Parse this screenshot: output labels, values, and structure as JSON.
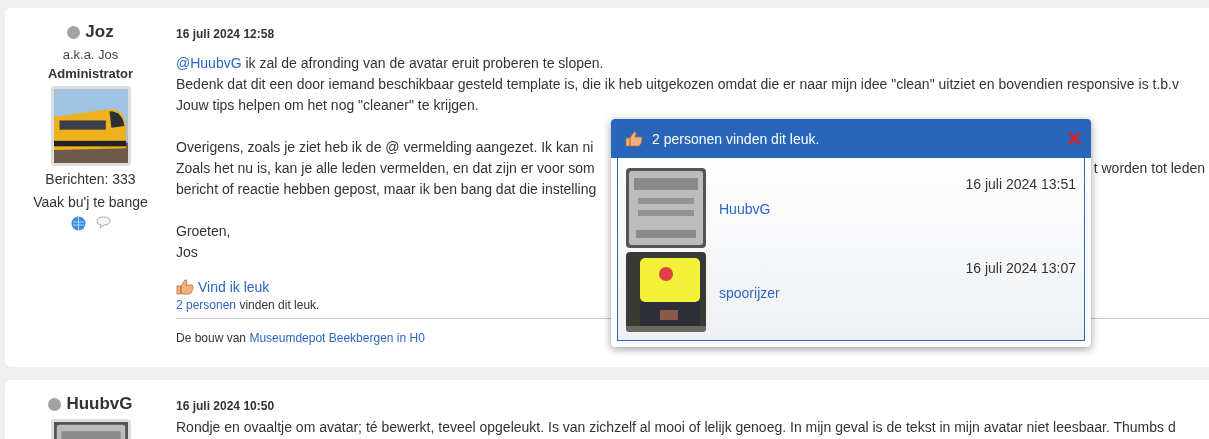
{
  "posts": [
    {
      "author": "Joz",
      "online": false,
      "alias": "a.k.a. Jos",
      "rank": "Administrator",
      "avatar": {
        "kind": "picture"
      },
      "post_count": "Berichten: 333",
      "personal_text": "Vaak bu'j te bange",
      "date": "16 juli 2024 12:58",
      "lines": [
        {
          "kind": "text",
          "segments": [
            {
              "kind": "mention",
              "text": "@HuubvG"
            },
            {
              "kind": "text",
              "text": " ik zal de afronding van de avatar eruit proberen te slopen."
            }
          ]
        },
        {
          "kind": "text",
          "segments": [
            {
              "kind": "text",
              "text": "Bedenk dat dit een door iemand beschikbaar gesteld template is, die ik heb uitgekozen omdat die er naar mijn idee \"clean\" uitziet en bovendien responsive is t.b.v"
            }
          ]
        },
        {
          "kind": "text",
          "segments": [
            {
              "kind": "text",
              "text": "Jouw tips helpen om het nog \"cleaner\" te krijgen."
            }
          ]
        },
        {
          "kind": "blank"
        },
        {
          "kind": "text",
          "segments": [
            {
              "kind": "text",
              "text": "Overigens, zoals je ziet heb ik de @ vermelding aangezet. Ik kan ni"
            }
          ]
        },
        {
          "kind": "split",
          "segments": [
            {
              "kind": "text",
              "text": "Zoals het nu is, kan je alle leden vermelden, en dat zijn er voor som"
            },
            {
              "kind": "right",
              "text": "t worden tot leden"
            }
          ]
        },
        {
          "kind": "text",
          "segments": [
            {
              "kind": "text",
              "text": "bericht of reactie hebben gepost, maar ik ben bang dat die instelling"
            }
          ]
        },
        {
          "kind": "blank"
        },
        {
          "kind": "text",
          "segments": [
            {
              "kind": "text",
              "text": "Groeten,"
            }
          ]
        },
        {
          "kind": "text",
          "segments": [
            {
              "kind": "text",
              "text": "Jos"
            }
          ]
        }
      ],
      "like_button": "Vind ik leuk",
      "likes_link": "2 personen",
      "likes_text": " vinden dit leuk.",
      "signature": {
        "text": "De bouw van ",
        "link": "Museumdepot Beekbergen in H0"
      },
      "likes_popup": {
        "title": "2 personen vinden dit leuk.",
        "entries": [
          {
            "name": "HuubvG",
            "date": "16 juli 2024 13:51"
          },
          {
            "name": "spoorijzer",
            "date": "16 juli 2024 13:07"
          }
        ]
      }
    },
    {
      "author": "HuubvG",
      "online": false,
      "avatar": {
        "kind": "picture"
      },
      "date": "16 juli 2024 10:50",
      "lines": [
        {
          "kind": "text",
          "segments": [
            {
              "kind": "text",
              "text": "Rondje en ovaaltje om avatar; té bewerkt, teveel opgeleukt. Is van zichzelf al mooi of lelijk genoeg. In mijn geval is de tekst in mijn avatar niet leesbaar. Thumbs d"
            }
          ]
        }
      ]
    }
  ]
}
